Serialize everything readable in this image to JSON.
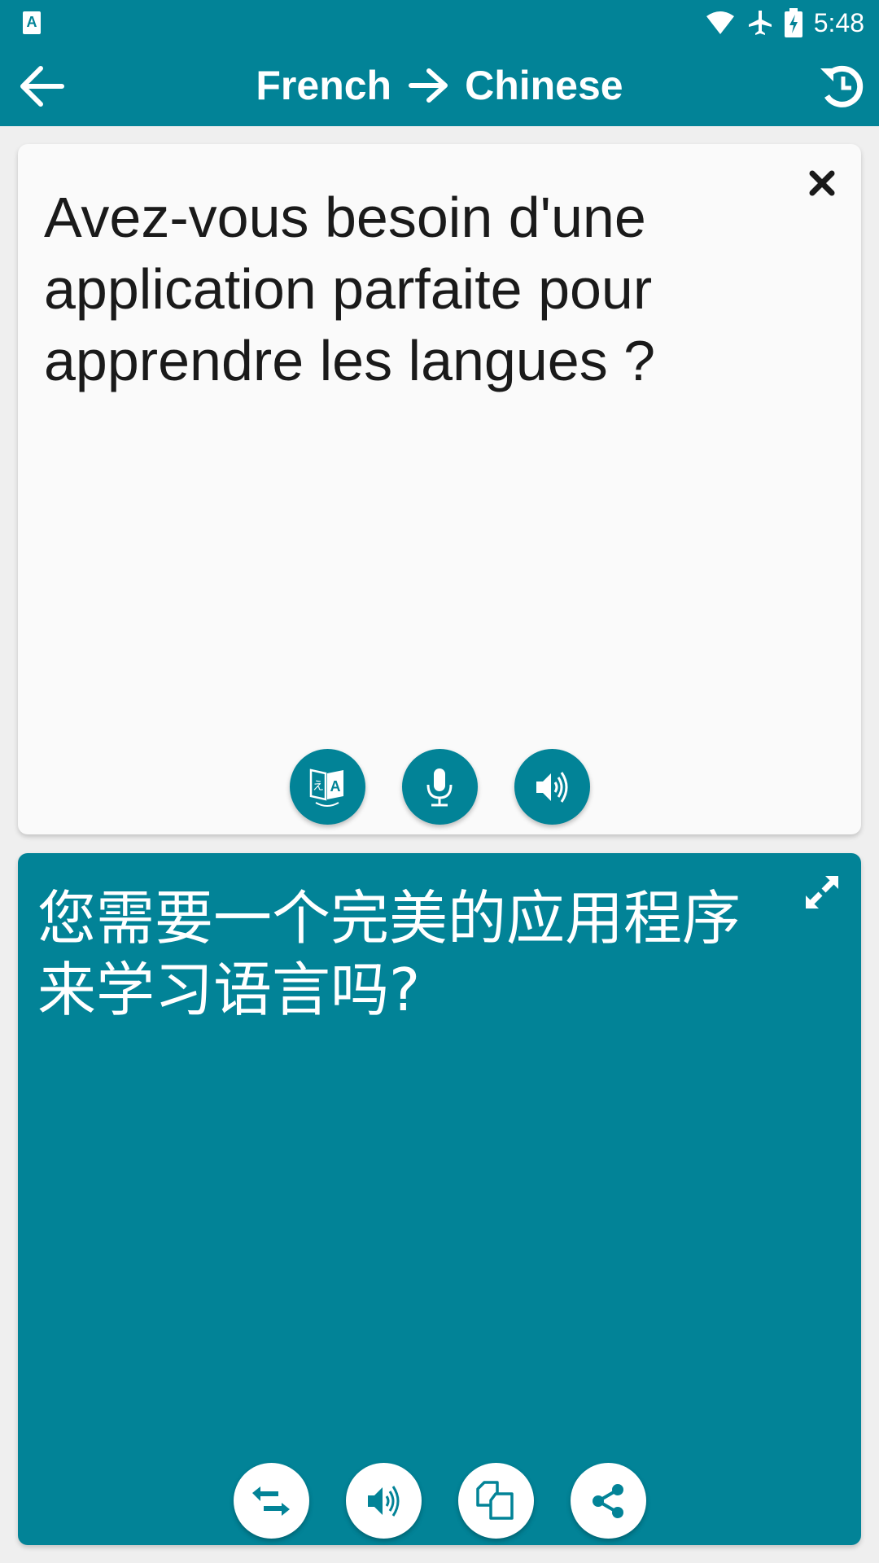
{
  "status_bar": {
    "time": "5:48",
    "left_icon": "translate-notification-icon",
    "right_icons": [
      "wifi-icon",
      "airplane-icon",
      "battery-charging-icon"
    ]
  },
  "app_bar": {
    "source_language": "French",
    "arrow": "→",
    "target_language": "Chinese",
    "back_icon": "arrow-left-icon",
    "history_icon": "history-icon"
  },
  "source_card": {
    "text": "Avez-vous besoin d'une application parfaite pour apprendre les langues ?",
    "buttons": [
      {
        "name": "translate-button",
        "icon": "translate-icon"
      },
      {
        "name": "microphone-button",
        "icon": "microphone-icon"
      },
      {
        "name": "speak-source-button",
        "icon": "speaker-icon"
      }
    ]
  },
  "target_card": {
    "text": "您需要一个完美的应用程序来学习语言吗?",
    "buttons": [
      {
        "name": "swap-languages-button",
        "icon": "swap-icon"
      },
      {
        "name": "speak-translation-button",
        "icon": "speaker-icon"
      },
      {
        "name": "copy-button",
        "icon": "copy-icon"
      },
      {
        "name": "share-button",
        "icon": "share-icon"
      }
    ]
  },
  "colors": {
    "primary": "#028397",
    "source_card_bg": "#fafafa",
    "background": "#efefef"
  }
}
